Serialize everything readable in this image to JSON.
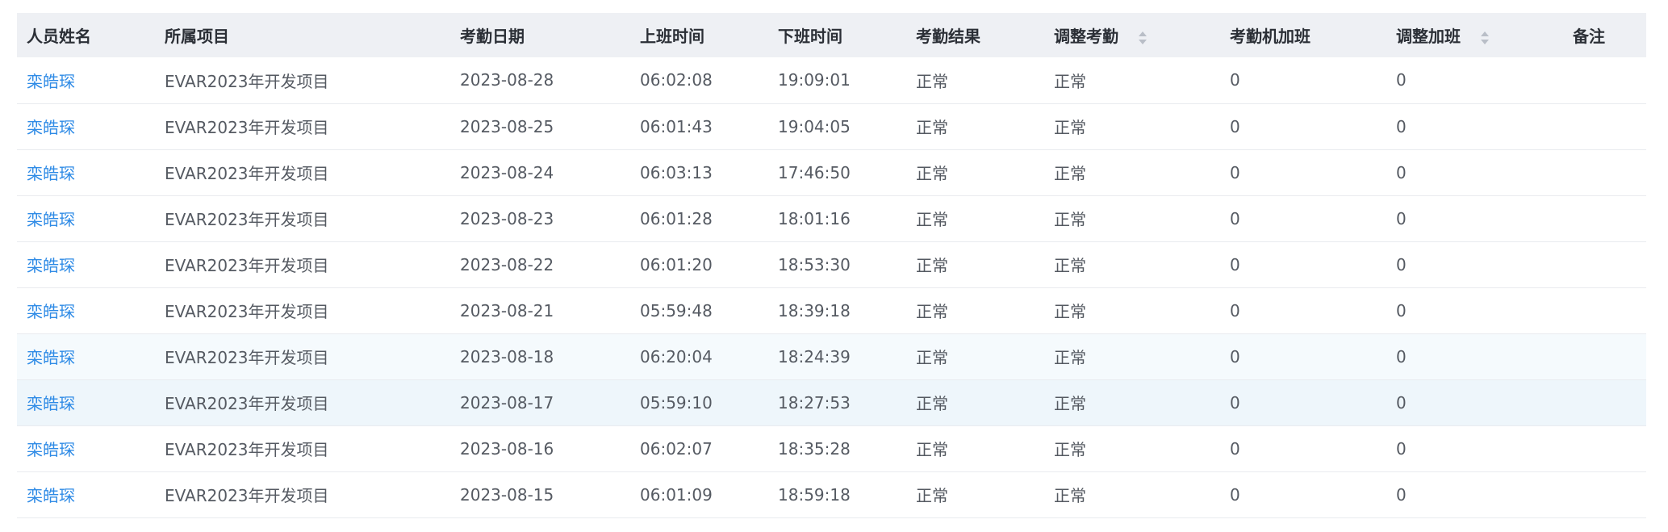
{
  "columns": {
    "name": "人员姓名",
    "project": "所属项目",
    "date": "考勤日期",
    "in": "上班时间",
    "out": "下班时间",
    "result": "考勤结果",
    "adjust": "调整考勤",
    "machine_ot": "考勤机加班",
    "adjust_ot": "调整加班",
    "remark": "备注"
  },
  "rows": [
    {
      "name": "栾皓琛",
      "project": "EVAR2023年开发项目",
      "date": "2023-08-28",
      "in": "06:02:08",
      "out": "19:09:01",
      "result": "正常",
      "adjust": "正常",
      "machine_ot": "0",
      "adjust_ot": "0",
      "remark": ""
    },
    {
      "name": "栾皓琛",
      "project": "EVAR2023年开发项目",
      "date": "2023-08-25",
      "in": "06:01:43",
      "out": "19:04:05",
      "result": "正常",
      "adjust": "正常",
      "machine_ot": "0",
      "adjust_ot": "0",
      "remark": ""
    },
    {
      "name": "栾皓琛",
      "project": "EVAR2023年开发项目",
      "date": "2023-08-24",
      "in": "06:03:13",
      "out": "17:46:50",
      "result": "正常",
      "adjust": "正常",
      "machine_ot": "0",
      "adjust_ot": "0",
      "remark": ""
    },
    {
      "name": "栾皓琛",
      "project": "EVAR2023年开发项目",
      "date": "2023-08-23",
      "in": "06:01:28",
      "out": "18:01:16",
      "result": "正常",
      "adjust": "正常",
      "machine_ot": "0",
      "adjust_ot": "0",
      "remark": ""
    },
    {
      "name": "栾皓琛",
      "project": "EVAR2023年开发项目",
      "date": "2023-08-22",
      "in": "06:01:20",
      "out": "18:53:30",
      "result": "正常",
      "adjust": "正常",
      "machine_ot": "0",
      "adjust_ot": "0",
      "remark": ""
    },
    {
      "name": "栾皓琛",
      "project": "EVAR2023年开发项目",
      "date": "2023-08-21",
      "in": "05:59:48",
      "out": "18:39:18",
      "result": "正常",
      "adjust": "正常",
      "machine_ot": "0",
      "adjust_ot": "0",
      "remark": ""
    },
    {
      "name": "栾皓琛",
      "project": "EVAR2023年开发项目",
      "date": "2023-08-18",
      "in": "06:20:04",
      "out": "18:24:39",
      "result": "正常",
      "adjust": "正常",
      "machine_ot": "0",
      "adjust_ot": "0",
      "remark": ""
    },
    {
      "name": "栾皓琛",
      "project": "EVAR2023年开发项目",
      "date": "2023-08-17",
      "in": "05:59:10",
      "out": "18:27:53",
      "result": "正常",
      "adjust": "正常",
      "machine_ot": "0",
      "adjust_ot": "0",
      "remark": ""
    },
    {
      "name": "栾皓琛",
      "project": "EVAR2023年开发项目",
      "date": "2023-08-16",
      "in": "06:02:07",
      "out": "18:35:28",
      "result": "正常",
      "adjust": "正常",
      "machine_ot": "0",
      "adjust_ot": "0",
      "remark": ""
    },
    {
      "name": "栾皓琛",
      "project": "EVAR2023年开发项目",
      "date": "2023-08-15",
      "in": "06:01:09",
      "out": "18:59:18",
      "result": "正常",
      "adjust": "正常",
      "machine_ot": "0",
      "adjust_ot": "0",
      "remark": ""
    }
  ],
  "colors": {
    "header_bg": "#eef0f4",
    "link": "#2f8be6",
    "row_hover": "#eef6fb"
  }
}
